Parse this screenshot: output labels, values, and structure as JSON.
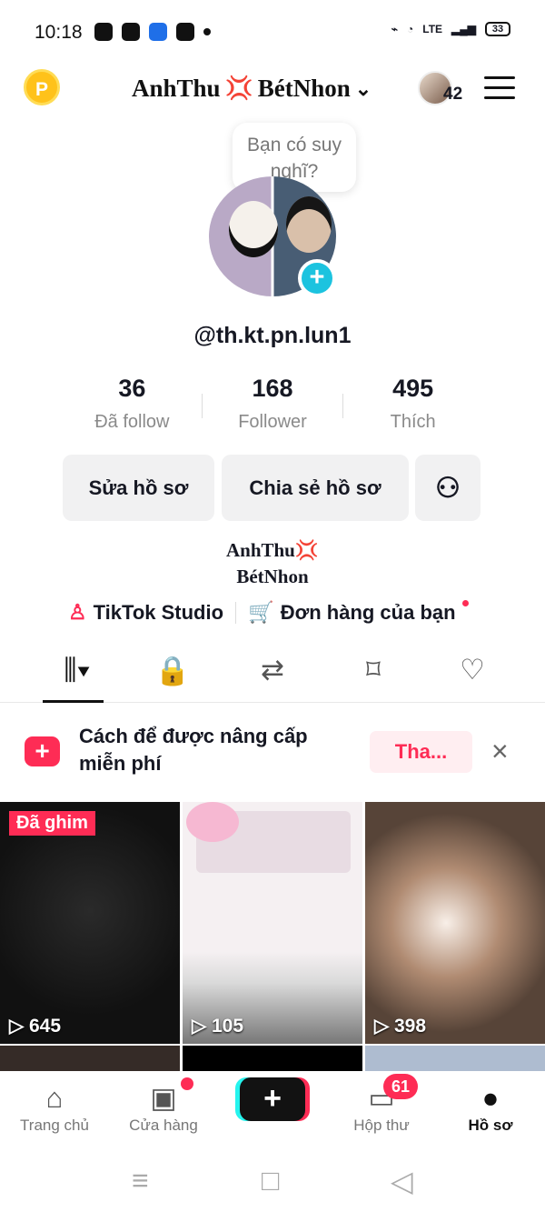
{
  "status_bar": {
    "time": "10:18",
    "battery": "33"
  },
  "header": {
    "coin_label": "P",
    "username": "AnhThu",
    "username_suffix": "BétNhon",
    "anger_symbol": "💢",
    "dropdown": "⌄",
    "visits": "42"
  },
  "tooltip": {
    "text": "Bạn có suy nghĩ?"
  },
  "profile": {
    "handle": "@th.kt.pn.lun1",
    "stats": [
      {
        "value": "36",
        "label": "Đã follow"
      },
      {
        "value": "168",
        "label": "Follower"
      },
      {
        "value": "495",
        "label": "Thích"
      }
    ],
    "buttons": {
      "edit": "Sửa hồ sơ",
      "share": "Chia sẻ hồ sơ"
    },
    "bio_line1": "AnhThu💢",
    "bio_line2": "BétNhon",
    "links": {
      "studio": "TikTok Studio",
      "orders": "Đơn hàng của bạn"
    }
  },
  "promo": {
    "text_line1": "Cách để được nâng cấp",
    "text_line2": "miễn phí",
    "button": "Tha...",
    "close": "×"
  },
  "videos": [
    {
      "pinned_label": "Đã ghim",
      "views": "645"
    },
    {
      "views": "105"
    },
    {
      "views": "398"
    }
  ],
  "bottom_nav": {
    "home": "Trang chủ",
    "shop": "Cửa hàng",
    "create": "+",
    "inbox": "Hộp thư",
    "inbox_badge": "61",
    "profile": "Hồ sơ"
  },
  "colors": {
    "brand_red": "#fe2c55",
    "cyan": "#25f4ee",
    "coin": "#ffc21a"
  },
  "icons": [
    "coin-icon",
    "menu-icon",
    "lock-icon",
    "repost-icon",
    "saved-icon",
    "liked-icon",
    "home-icon",
    "shop-icon",
    "inbox-icon",
    "profile-icon"
  ]
}
